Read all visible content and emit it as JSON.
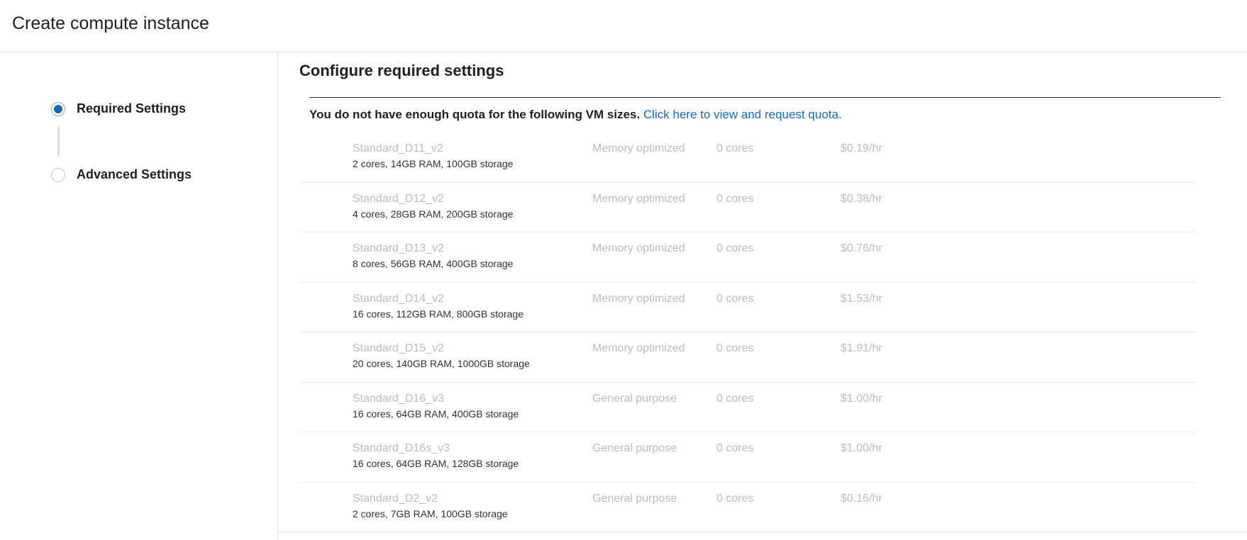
{
  "header": {
    "title": "Create compute instance"
  },
  "sidebar": {
    "steps": [
      {
        "label": "Required Settings",
        "active": true
      },
      {
        "label": "Advanced Settings",
        "active": false
      }
    ]
  },
  "main": {
    "section_title": "Configure required settings",
    "quota_message": "You do not have enough quota for the following VM sizes.",
    "quota_link": "Click here to view and request quota.",
    "vm_sizes": [
      {
        "name": "Standard_D11_v2",
        "spec": "2 cores, 14GB RAM, 100GB storage",
        "family": "Memory optimized",
        "cores": "0 cores",
        "price": "$0.19/hr"
      },
      {
        "name": "Standard_D12_v2",
        "spec": "4 cores, 28GB RAM, 200GB storage",
        "family": "Memory optimized",
        "cores": "0 cores",
        "price": "$0.38/hr"
      },
      {
        "name": "Standard_D13_v2",
        "spec": "8 cores, 56GB RAM, 400GB storage",
        "family": "Memory optimized",
        "cores": "0 cores",
        "price": "$0.76/hr"
      },
      {
        "name": "Standard_D14_v2",
        "spec": "16 cores, 112GB RAM, 800GB storage",
        "family": "Memory optimized",
        "cores": "0 cores",
        "price": "$1.53/hr"
      },
      {
        "name": "Standard_D15_v2",
        "spec": "20 cores, 140GB RAM, 1000GB storage",
        "family": "Memory optimized",
        "cores": "0 cores",
        "price": "$1.91/hr"
      },
      {
        "name": "Standard_D16_v3",
        "spec": "16 cores, 64GB RAM, 400GB storage",
        "family": "General purpose",
        "cores": "0 cores",
        "price": "$1.00/hr"
      },
      {
        "name": "Standard_D16s_v3",
        "spec": "16 cores, 64GB RAM, 128GB storage",
        "family": "General purpose",
        "cores": "0 cores",
        "price": "$1.00/hr"
      },
      {
        "name": "Standard_D2_v2",
        "spec": "2 cores, 7GB RAM, 100GB storage",
        "family": "General purpose",
        "cores": "0 cores",
        "price": "$0.16/hr"
      }
    ]
  },
  "colors": {
    "accent": "#0f6cbd",
    "disabled_text": "#bebbb8",
    "text": "#201f1e"
  }
}
